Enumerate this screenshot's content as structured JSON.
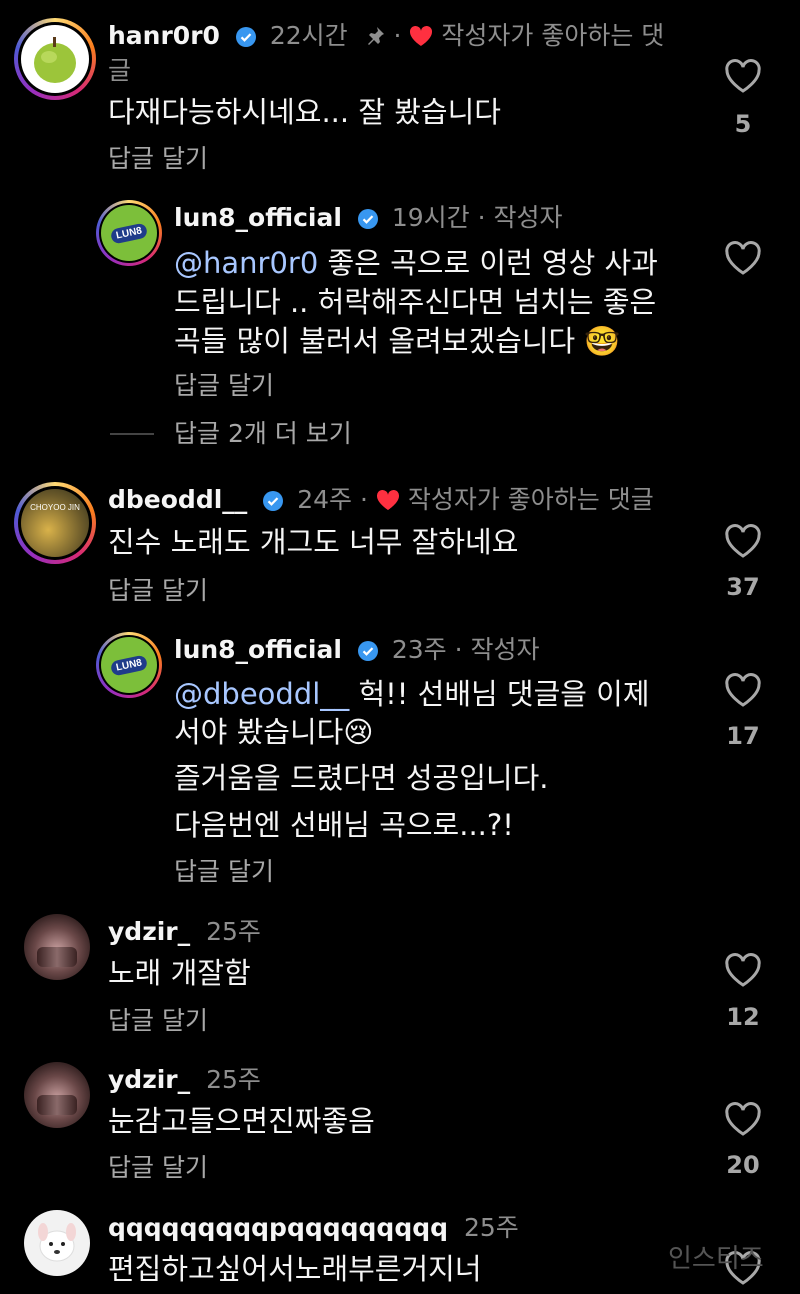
{
  "comments": [
    {
      "username": "hanr0r0",
      "time": "22시간",
      "pinned": true,
      "liked_by_author": "작성자가 좋아하는 댓",
      "liked_by_author_wrap": "글",
      "text": "다재다능하시네요... 잘 봤습니다",
      "reply_label": "답글 달기",
      "likes": "5"
    },
    {
      "username": "lun8_official",
      "time": "19시간 · 작성자",
      "mention": "@hanr0r0",
      "text_lines": [
        "좋은 곡으로 이런 영상 사과",
        "드립니다 .. 허락해주신다면 넘치는 좋은",
        "곡들 많이 불러서 올려보겠습니다 🤓"
      ],
      "reply_label": "답글 달기",
      "likes": ""
    },
    {
      "more_replies": "답글 2개 더 보기"
    },
    {
      "username": "dbeoddl__",
      "time": "24주",
      "liked_by_author": "작성자가 좋아하는 댓글",
      "text": "진수 노래도 개그도 너무 잘하네요",
      "reply_label": "답글 달기",
      "likes": "37"
    },
    {
      "username": "lun8_official",
      "time": "23주 · 작성자",
      "mention": "@dbeoddl__",
      "text_lines": [
        " 헉!! 선배님 댓글을 이제",
        "서야 봤습니다😢",
        "즐거움을 드렸다면 성공입니다.",
        "다음번엔 선배님 곡으로...?!"
      ],
      "reply_label": "답글 달기",
      "likes": "17"
    },
    {
      "username": "ydzir_",
      "time": "25주",
      "text": "노래 개잘함",
      "reply_label": "답글 달기",
      "likes": "12"
    },
    {
      "username": "ydzir_",
      "time": "25주",
      "text": "눈감고들으면진짜좋음",
      "reply_label": "답글 달기",
      "likes": "20"
    },
    {
      "username": "qqqqqqqqqpqqqqqqqqq",
      "time": "25주",
      "text": "편집하고싶어서노래부른거지너",
      "likes": ""
    }
  ],
  "badges": {
    "lun8_logo": "LUN8",
    "avatar_text_dbeoddl": "CHOYOO JIN"
  },
  "watermark": "인스티즈",
  "colors": {
    "background": "#000000",
    "verified": "#3897f0",
    "heart_red": "#ff3040",
    "mention": "#a8c7ff"
  }
}
